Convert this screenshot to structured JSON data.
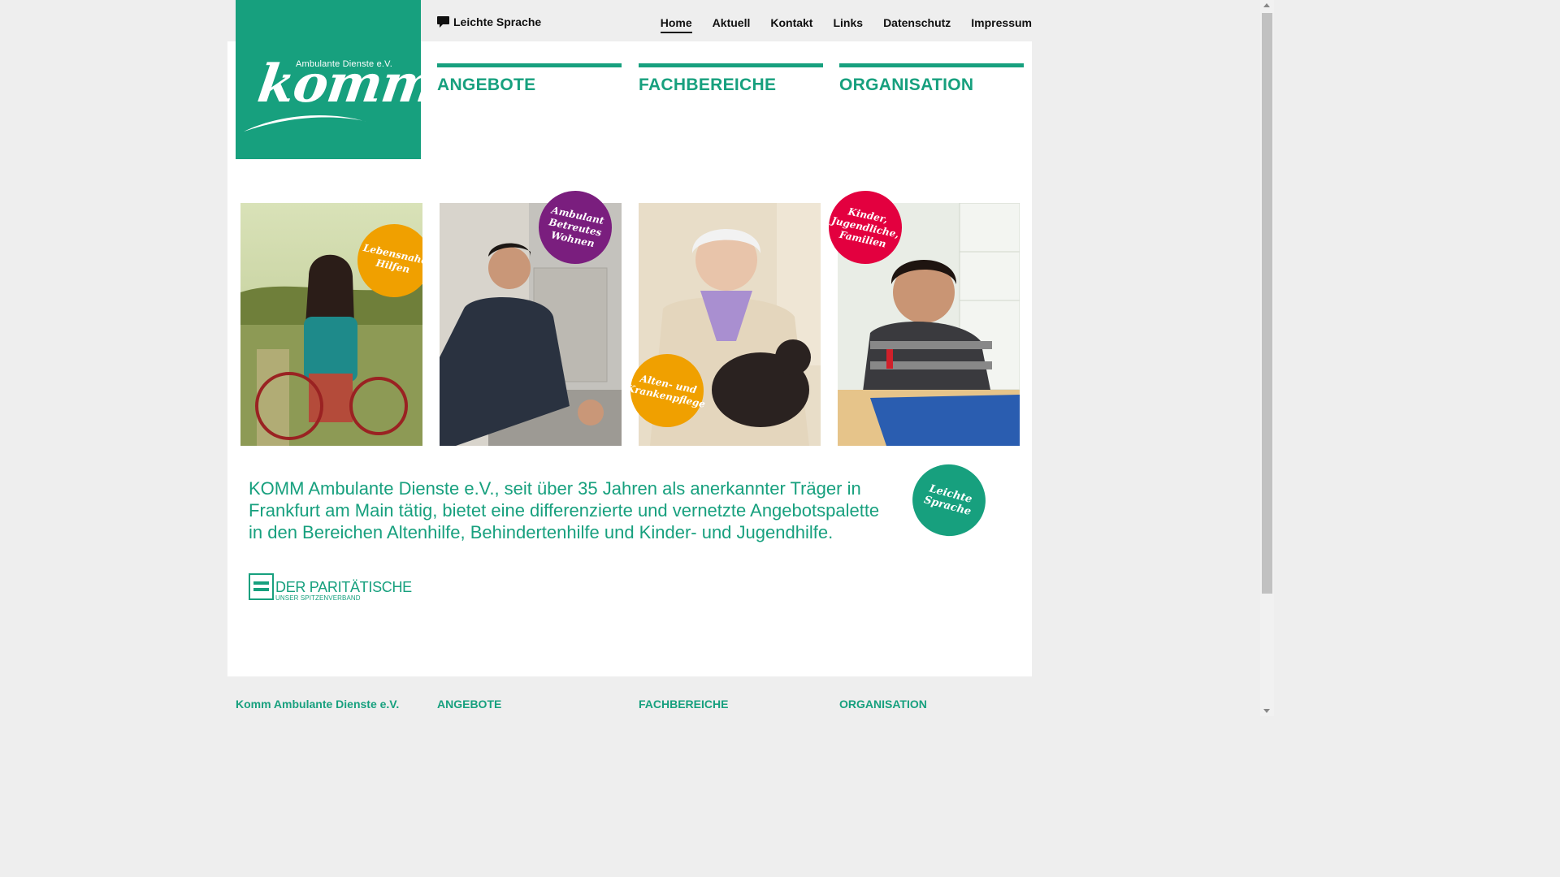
{
  "logo": {
    "tagline": "Ambulante Dienste e.V.",
    "wordmark": "komm"
  },
  "top_link": {
    "label": "Leichte Sprache",
    "icon": "speech-bubble-icon"
  },
  "nav": [
    {
      "label": "Home",
      "active": true
    },
    {
      "label": "Aktuell",
      "active": false
    },
    {
      "label": "Kontakt",
      "active": false
    },
    {
      "label": "Links",
      "active": false
    },
    {
      "label": "Datenschutz",
      "active": false
    },
    {
      "label": "Impressum",
      "active": false
    }
  ],
  "categories": [
    "ANGEBOTE",
    "FACHBEREICHE",
    "ORGANISATION"
  ],
  "tiles": [
    {
      "badge": "Lebensnahe Hilfen",
      "badge_color": "#f0a000"
    },
    {
      "badge": "Ambulant Betreutes Wohnen",
      "badge_color": "#7a1e7e"
    },
    {
      "badge": "Alten- und Krankenpflege",
      "badge_color": "#f0a000"
    },
    {
      "badge": "Kinder, Jugendliche, Familien",
      "badge_color": "#e3003f"
    }
  ],
  "intro": "KOMM Ambulante Dienste e.V., seit über 35 Jahren als anerkannter Träger in Frankfurt am Main tätig, bietet eine differenzierte und vernetzte Angebotspalette in den Bereichen Altenhilfe, Behindertenhilfe und Kinder- und Jugendhilfe.",
  "leichte_badge": "Leichte Sprache",
  "paritaet": {
    "name": "DER PARITÄTISCHE",
    "sub": "UNSER SPITZENVERBAND"
  },
  "footer": [
    "Komm Ambulante Dienste e.V.",
    "ANGEBOTE",
    "FACHBEREICHE",
    "ORGANISATION"
  ],
  "colors": {
    "brand": "#17a07e",
    "background": "#eeeeee"
  }
}
